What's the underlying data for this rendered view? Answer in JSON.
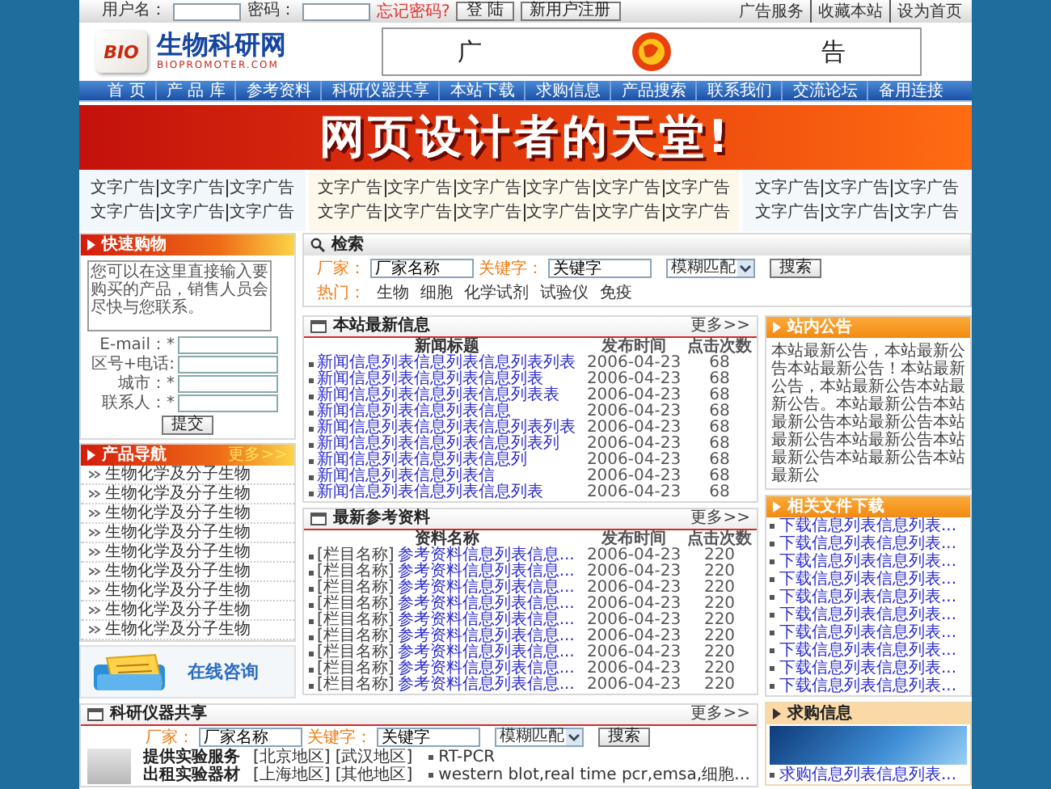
{
  "top_bar": {
    "username_label": "用户名：",
    "password_label": "密码：",
    "forgot_link": "忘记密码?",
    "login_button": "登 陆",
    "register_button": "新用户注册",
    "links": [
      "广告服务",
      "收藏本站",
      "设为首页"
    ]
  },
  "header": {
    "logo_badge": "BIO",
    "logo_title": "生物科研网",
    "logo_url": "BIOPROMOTER.COM",
    "ad": [
      "广",
      "告"
    ]
  },
  "nav": [
    "首 页",
    "产 品 库",
    "参考资料",
    "科研仪器共享",
    "本站下载",
    "求购信息",
    "产品搜索",
    "联系我们",
    "交流论坛",
    "备用连接"
  ],
  "banner": "网页设计者的天堂!",
  "text_ads": [
    [
      [
        "文字广告",
        "文字广告",
        "文字广告"
      ],
      [
        "文字广告",
        "文字广告",
        "文字广告"
      ]
    ],
    [
      [
        "文字广告",
        "文字广告",
        "文字广告",
        "文字广告",
        "文字广告",
        "文字广告"
      ],
      [
        "文字广告",
        "文字广告",
        "文字广告",
        "文字广告",
        "文字广告",
        "文字广告"
      ]
    ],
    [
      [
        "文字广告",
        "文字广告",
        "文字广告"
      ],
      [
        "文字广告",
        "文字广告",
        "文字广告"
      ]
    ]
  ],
  "quick_shop": {
    "title": "快速购物",
    "message": "您可以在这里直接输入要购买的产品，销售人员会尽快与您联系。",
    "fields": [
      "E-mail：*",
      "区号+电话:",
      "城市：*",
      "联系人：*"
    ],
    "submit": "提交"
  },
  "product_nav": {
    "title": "产品导航",
    "more": "更多>>",
    "items": [
      "生物化学及分子生物",
      "生物化学及分子生物",
      "生物化学及分子生物",
      "生物化学及分子生物",
      "生物化学及分子生物",
      "生物化学及分子生物",
      "生物化学及分子生物",
      "生物化学及分子生物",
      "生物化学及分子生物"
    ]
  },
  "consult": {
    "label": "在线咨询"
  },
  "search": {
    "title": "检索",
    "factory_label": "厂家：",
    "factory_value": "厂家名称",
    "keyword_label": "关键字：",
    "keyword_value": "关键字",
    "match": "模糊匹配",
    "button": "搜索",
    "hot_label": "热门：",
    "hot": [
      "生物",
      "细胞",
      "化学试剂",
      "试验仪",
      "免疫"
    ]
  },
  "news": {
    "title": "本站最新信息",
    "more": "更多>>",
    "columns": [
      "新闻标题",
      "发布时间",
      "点击次数"
    ],
    "rows": [
      {
        "title": "新闻信息列表信息列表信息列表列表",
        "date": "2006-04-23",
        "hits": "68"
      },
      {
        "title": "新闻信息列表信息列表信息列表",
        "date": "2006-04-23",
        "hits": "68"
      },
      {
        "title": "新闻信息列表信息列表信息列表表",
        "date": "2006-04-23",
        "hits": "68"
      },
      {
        "title": "新闻信息列表信息列表信息",
        "date": "2006-04-23",
        "hits": "68"
      },
      {
        "title": "新闻信息列表信息列表信息列表列表",
        "date": "2006-04-23",
        "hits": "68"
      },
      {
        "title": "新闻信息列表信息列表信息列表列",
        "date": "2006-04-23",
        "hits": "68"
      },
      {
        "title": "新闻信息列表信息列表信息列",
        "date": "2006-04-23",
        "hits": "68"
      },
      {
        "title": "新闻信息列表信息列表信",
        "date": "2006-04-23",
        "hits": "68"
      },
      {
        "title": "新闻信息列表信息列表信息列表",
        "date": "2006-04-23",
        "hits": "68"
      }
    ]
  },
  "references": {
    "title": "最新参考资料",
    "more": "更多>>",
    "columns": [
      "资料名称",
      "发布时间",
      "点击次数"
    ],
    "rows": [
      {
        "category": "[栏目名称]",
        "title": "参考资料信息列表信息...",
        "date": "2006-04-23",
        "hits": "220"
      },
      {
        "category": "[栏目名称]",
        "title": "参考资料信息列表信息...",
        "date": "2006-04-23",
        "hits": "220"
      },
      {
        "category": "[栏目名称]",
        "title": "参考资料信息列表信息...",
        "date": "2006-04-23",
        "hits": "220"
      },
      {
        "category": "[栏目名称]",
        "title": "参考资料信息列表信息...",
        "date": "2006-04-23",
        "hits": "220"
      },
      {
        "category": "[栏目名称]",
        "title": "参考资料信息列表信息...",
        "date": "2006-04-23",
        "hits": "220"
      },
      {
        "category": "[栏目名称]",
        "title": "参考资料信息列表信息...",
        "date": "2006-04-23",
        "hits": "220"
      },
      {
        "category": "[栏目名称]",
        "title": "参考资料信息列表信息...",
        "date": "2006-04-23",
        "hits": "220"
      },
      {
        "category": "[栏目名称]",
        "title": "参考资料信息列表信息...",
        "date": "2006-04-23",
        "hits": "220"
      },
      {
        "category": "[栏目名称]",
        "title": "参考资料信息列表信息...",
        "date": "2006-04-23",
        "hits": "220"
      }
    ]
  },
  "notice": {
    "title": "站内公告",
    "text": "本站最新公告，本站最新公告本站最新公告！本站最新公告，本站最新公告本站最新公告。本站最新公告本站最新公告本站最新公告本站最新公告本站最新公告本站最新公告本站最新公告本站最新公"
  },
  "downloads": {
    "title": "相关文件下载",
    "items": [
      "下载信息列表信息列表...",
      "下载信息列表信息列表...",
      "下载信息列表信息列表...",
      "下载信息列表信息列表...",
      "下载信息列表信息列表...",
      "下载信息列表信息列表...",
      "下载信息列表信息列表...",
      "下载信息列表信息列表...",
      "下载信息列表信息列表...",
      "下载信息列表信息列表..."
    ]
  },
  "purchase": {
    "title": "求购信息",
    "items": [
      "求购信息列表信息列表..."
    ]
  },
  "instrument_share": {
    "title": "科研仪器共享",
    "more": "更多>>",
    "factory_label": "厂家：",
    "factory_value": "厂家名称",
    "keyword_label": "关键字：",
    "keyword_value": "关键字",
    "match": "模糊匹配",
    "button": "搜索",
    "services": [
      "提供实验服务",
      "出租实验器材"
    ],
    "regions": [
      "[北京地区]",
      "[武汉地区]",
      "[上海地区]",
      "[其他地区]"
    ],
    "items": [
      "RT-PCR",
      "western blot,real time pcr,emsa,细胞…"
    ]
  }
}
